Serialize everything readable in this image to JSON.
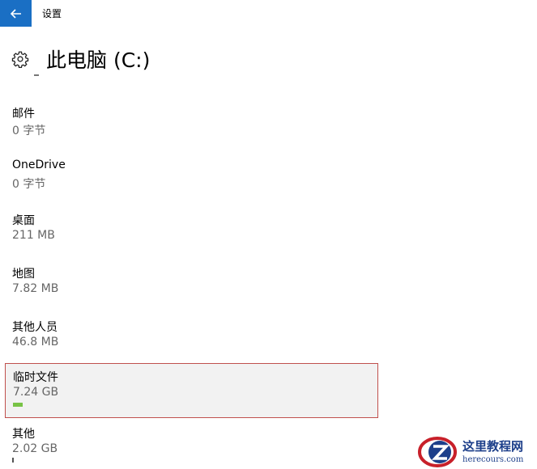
{
  "window": {
    "title": "设置"
  },
  "page": {
    "title": "此电脑 (C:)"
  },
  "items": [
    {
      "name": "邮件",
      "size": "0 字节"
    },
    {
      "name": "OneDrive",
      "size": "0 字节"
    },
    {
      "name": "桌面",
      "size": "211 MB"
    },
    {
      "name": "地图",
      "size": "7.82 MB"
    },
    {
      "name": "其他人员",
      "size": "46.8 MB"
    },
    {
      "name": "临时文件",
      "size": "7.24 GB",
      "selected": true
    },
    {
      "name": "其他",
      "size": "2.02 GB"
    }
  ],
  "watermark": {
    "text": "这里教程网",
    "url": "herecours.com"
  },
  "colors": {
    "accent": "#1a6fc4",
    "highlight_border": "#c0504d",
    "usage_bar": "#78c346"
  }
}
